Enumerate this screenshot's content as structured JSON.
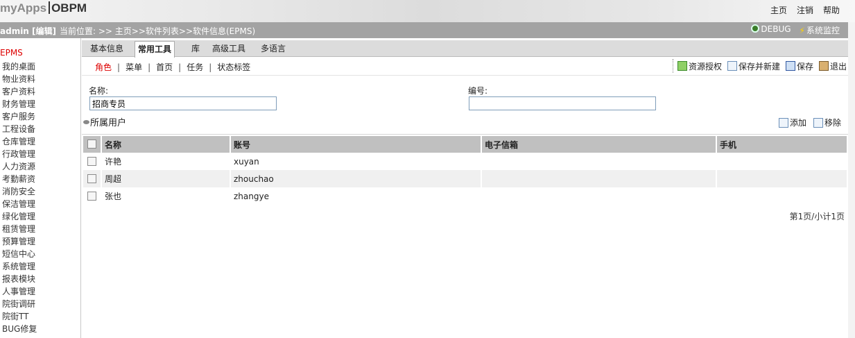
{
  "header": {
    "logo_prefix": "myApps",
    "logo_suffix": "OBPM",
    "links": [
      "主页",
      "注销",
      "帮助"
    ]
  },
  "status": {
    "user": "admin [编辑]",
    "breadcrumb": "当前位置: >> 主页>>软件列表>>软件信息(EPMS)",
    "debug": "DEBUG",
    "monitor": "系统监控"
  },
  "sidebar": {
    "root": "EPMS",
    "items": [
      "我的桌面",
      "物业资料",
      "客户资料",
      "财务管理",
      "客户服务",
      "工程设备",
      "仓库管理",
      "行政管理",
      "人力资源",
      "考勤薪资",
      "消防安全",
      "保洁管理",
      "绿化管理",
      "租赁管理",
      "预算管理",
      "短信中心",
      "系统管理",
      "报表模块",
      "人事管理",
      "院街调研",
      "院街TT",
      "BUG修复"
    ]
  },
  "tabs": [
    "基本信息",
    "常用工具",
    "库",
    "高级工具",
    "多语言"
  ],
  "subtabs": [
    "角色",
    "菜单",
    "首页",
    "任务",
    "状态标签"
  ],
  "actions": [
    "资源授权",
    "保存并新建",
    "保存",
    "退出"
  ],
  "form": {
    "name_label": "名称:",
    "name_value": "招商专员",
    "code_label": "编号:",
    "code_value": ""
  },
  "users_section": {
    "title": "所属用户",
    "add": "添加",
    "remove": "移除"
  },
  "table": {
    "headers": [
      "名称",
      "账号",
      "电子信箱",
      "手机"
    ],
    "rows": [
      [
        "许艳",
        "xuyan",
        "",
        ""
      ],
      [
        "周超",
        "zhouchao",
        "",
        ""
      ],
      [
        "张也",
        "zhangye",
        "",
        ""
      ]
    ]
  },
  "pager": "第1页/小计1页"
}
